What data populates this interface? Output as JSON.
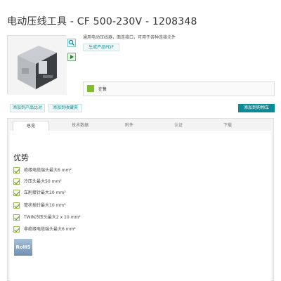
{
  "header": {
    "title": "电动压线工具 - CF 500-230V - 1208348"
  },
  "product": {
    "description": "通用电动压线器，面连接口，可用于各种连接元件",
    "pdf_button": "生成产品PDF",
    "image_icon": "crimping-machine-image",
    "zoom_icon": "magnifier-icon",
    "video_icon": "video-play-icon"
  },
  "stock": {
    "status_text": "在售",
    "status_color": "#7cbf2a"
  },
  "actions": {
    "compare": "添加到产品比对",
    "favorites": "添加到收藏夹",
    "cart": "添加到购物车",
    "accent_color": "#0a8a94"
  },
  "tabs": [
    {
      "label": "总览",
      "active": true
    },
    {
      "label": "技术数据",
      "active": false
    },
    {
      "label": "附件",
      "active": false
    },
    {
      "label": "认证",
      "active": false
    },
    {
      "label": "下载",
      "active": false
    }
  ],
  "advantages": {
    "title": "优势",
    "items": [
      "绝缘电缆端头最大6 mm²",
      "冷压头最大50 mm²",
      "车削接针最大10 mm²",
      "管状插针最大10 mm²",
      "TWIN冷压头最大2 x 10 mm²",
      "非绝缘电缆端头最大6 mm²"
    ]
  },
  "badge": {
    "rohs": "RoHS"
  }
}
